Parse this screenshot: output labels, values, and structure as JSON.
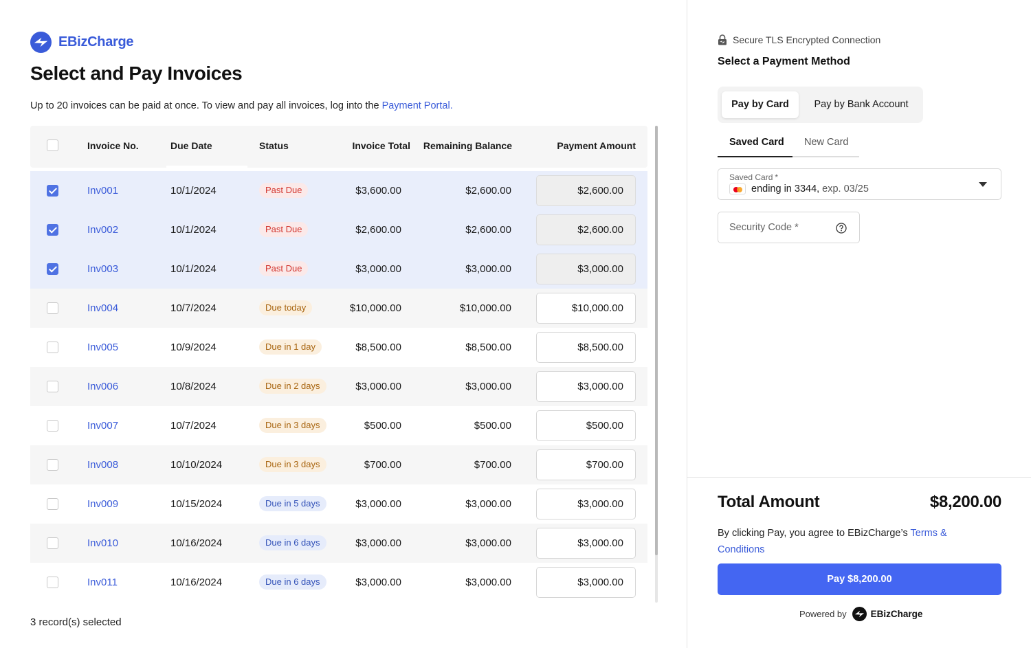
{
  "brand": {
    "name": "EBizCharge",
    "accent": "#3a5bd9"
  },
  "page": {
    "title": "Select and Pay Invoices",
    "subtitle": "Up to 20 invoices can be paid at once. To view and pay all invoices, log into the",
    "portal_link": "Payment Portal."
  },
  "table": {
    "headers": [
      "Invoice No.",
      "Due Date",
      "Status",
      "Invoice Total",
      "Remaining Balance",
      "Payment Amount"
    ],
    "rows": [
      {
        "selected": true,
        "invoice": "Inv001",
        "due": "10/1/2024",
        "status": "Past Due",
        "status_kind": "past",
        "total": "$3,600.00",
        "remaining": "$2,600.00",
        "payment": "$2,600.00"
      },
      {
        "selected": true,
        "invoice": "Inv002",
        "due": "10/1/2024",
        "status": "Past Due",
        "status_kind": "past",
        "total": "$2,600.00",
        "remaining": "$2,600.00",
        "payment": "$2,600.00"
      },
      {
        "selected": true,
        "invoice": "Inv003",
        "due": "10/1/2024",
        "status": "Past Due",
        "status_kind": "past",
        "total": "$3,000.00",
        "remaining": "$3,000.00",
        "payment": "$3,000.00"
      },
      {
        "selected": false,
        "invoice": "Inv004",
        "due": "10/7/2024",
        "status": "Due today",
        "status_kind": "today",
        "total": "$10,000.00",
        "remaining": "$10,000.00",
        "payment": "$10,000.00"
      },
      {
        "selected": false,
        "invoice": "Inv005",
        "due": "10/9/2024",
        "status": "Due in 1 day",
        "status_kind": "soon",
        "total": "$8,500.00",
        "remaining": "$8,500.00",
        "payment": "$8,500.00"
      },
      {
        "selected": false,
        "invoice": "Inv006",
        "due": "10/8/2024",
        "status": "Due in 2 days",
        "status_kind": "soon",
        "total": "$3,000.00",
        "remaining": "$3,000.00",
        "payment": "$3,000.00"
      },
      {
        "selected": false,
        "invoice": "Inv007",
        "due": "10/7/2024",
        "status": "Due in 3 days",
        "status_kind": "soon",
        "total": "$500.00",
        "remaining": "$500.00",
        "payment": "$500.00"
      },
      {
        "selected": false,
        "invoice": "Inv008",
        "due": "10/10/2024",
        "status": "Due in 3 days",
        "status_kind": "soon",
        "total": "$700.00",
        "remaining": "$700.00",
        "payment": "$700.00"
      },
      {
        "selected": false,
        "invoice": "Inv009",
        "due": "10/15/2024",
        "status": "Due in 5 days",
        "status_kind": "later",
        "total": "$3,000.00",
        "remaining": "$3,000.00",
        "payment": "$3,000.00"
      },
      {
        "selected": false,
        "invoice": "Inv010",
        "due": "10/16/2024",
        "status": "Due in 6 days",
        "status_kind": "later",
        "total": "$3,000.00",
        "remaining": "$3,000.00",
        "payment": "$3,000.00"
      },
      {
        "selected": false,
        "invoice": "Inv011",
        "due": "10/16/2024",
        "status": "Due in 6 days",
        "status_kind": "later",
        "total": "$3,000.00",
        "remaining": "$3,000.00",
        "payment": "$3,000.00"
      }
    ],
    "records_selected": "3 record(s) selected"
  },
  "payment": {
    "secure_text": "Secure TLS Encrypted Connection",
    "method_title": "Select a Payment Method",
    "method_tabs": [
      "Pay by Card",
      "Pay by Bank Account"
    ],
    "card_tabs": [
      "Saved Card",
      "New Card"
    ],
    "saved_card_label": "Saved Card",
    "required_mark": "*",
    "saved_card_value": "ending in 3344,",
    "saved_card_exp": "exp. 03/25",
    "security_code_placeholder": "Security Code *",
    "total_label": "Total Amount",
    "total_value": "$8,200.00",
    "agree_text": "By clicking Pay, you agree to EBizCharge’s",
    "terms_link": "Terms & Conditions",
    "pay_button": "Pay $8,200.00",
    "powered_by": "Powered by",
    "powered_brand": "EBizCharge",
    "button_color": "#4466f2"
  }
}
